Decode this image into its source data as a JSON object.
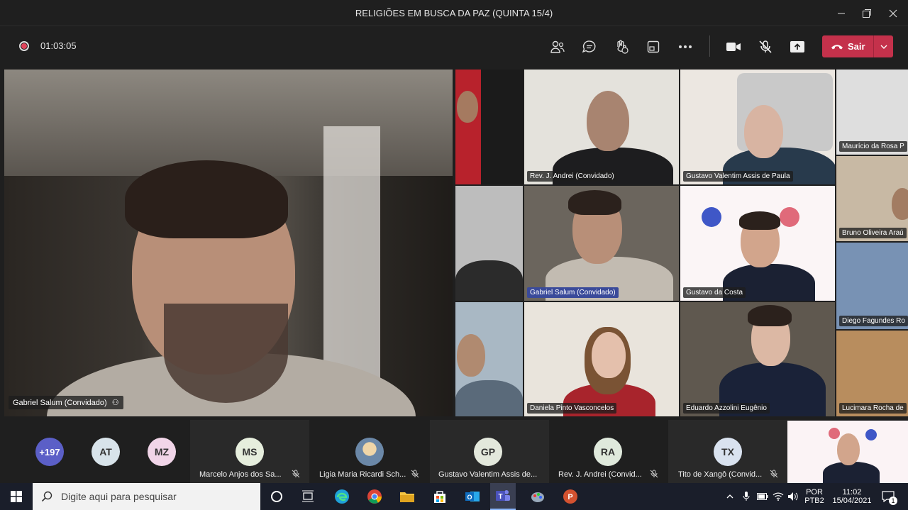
{
  "window": {
    "title": "RELIGIÕES EM BUSCA DA PAZ (QUINTA 15/4)"
  },
  "toolbar": {
    "timer": "01:03:05",
    "icons": [
      "people-icon",
      "chat-icon",
      "raise-hand-icon",
      "share-tray-icon",
      "more-icon",
      "camera-icon",
      "mic-off-icon",
      "share-icon"
    ],
    "leave_label": "Sair"
  },
  "main_video": {
    "name": "Gabriel Salum (Convidado)"
  },
  "grid": [
    {
      "name": "Rev. J. Andrei (Convidado)"
    },
    {
      "name": "Gustavo Valentim Assis de Paula"
    },
    {
      "name": "Maurício da Rosa P"
    },
    {
      "name": "Bruno Oliveira Araú"
    },
    {
      "name": "Gabriel Salum (Convidado)"
    },
    {
      "name": "Gustavo da Costa"
    },
    {
      "name": "Diego Fagundes Ro"
    },
    {
      "name": "Daniela Pinto Vasconcelos"
    },
    {
      "name": "Eduardo Azzolini Eugênio"
    },
    {
      "name": "Lucimara Rocha de"
    }
  ],
  "participants": {
    "overflow_count": "+197",
    "avatars": [
      {
        "initials": "AT",
        "color": "#d8e3ea"
      },
      {
        "initials": "MZ",
        "color": "#f1d5e8"
      }
    ],
    "named": [
      {
        "initials": "MS",
        "name": "Marcelo Anjos dos Sa...",
        "color": "#e6eedd"
      },
      {
        "initials": "",
        "name": "Ligia Maria Ricardi Sch...",
        "color": "#6b88a8"
      },
      {
        "initials": "GP",
        "name": "Gustavo Valentim Assis de...",
        "color": "#e3e8dc"
      },
      {
        "initials": "RA",
        "name": "Rev. J. Andrei (Convid...",
        "color": "#dfe9dc"
      },
      {
        "initials": "TX",
        "name": "Tito de Xangô (Convid...",
        "color": "#d9e2ef"
      }
    ]
  },
  "taskbar": {
    "search_placeholder": "Digite aqui para pesquisar",
    "language": "POR",
    "layout": "PTB2",
    "time": "11:02",
    "date": "15/04/2021",
    "notifications": "1"
  }
}
